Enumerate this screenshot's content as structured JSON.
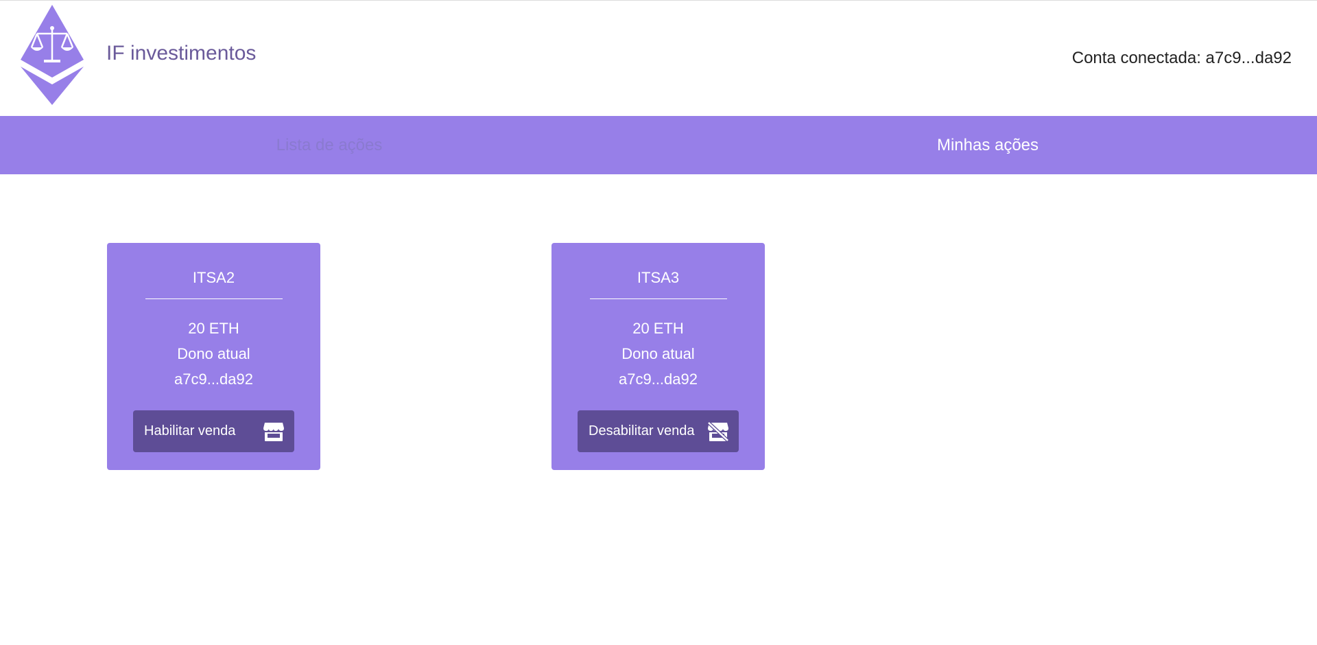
{
  "header": {
    "brand": "IF investimentos",
    "account": "Conta conectada: a7c9...da92",
    "logo_icon": "ethereum-scales-logo"
  },
  "nav": {
    "tabs": [
      {
        "label": "Lista de ações",
        "active": false
      },
      {
        "label": "Minhas ações",
        "active": true
      }
    ]
  },
  "cards": [
    {
      "ticker": "ITSA2",
      "price": "20 ETH",
      "owner_label": "Dono atual",
      "owner": "a7c9...da92",
      "button_label": "Habilitar venda",
      "button_icon": "store-icon"
    },
    {
      "ticker": "ITSA3",
      "price": "20 ETH",
      "owner_label": "Dono atual",
      "owner": "a7c9...da92",
      "button_label": "Desabilitar venda",
      "button_icon": "store-slash-icon"
    }
  ],
  "colors": {
    "accent": "#977fe8",
    "button": "#5e4d96",
    "brand_text": "#6a5a9a"
  }
}
